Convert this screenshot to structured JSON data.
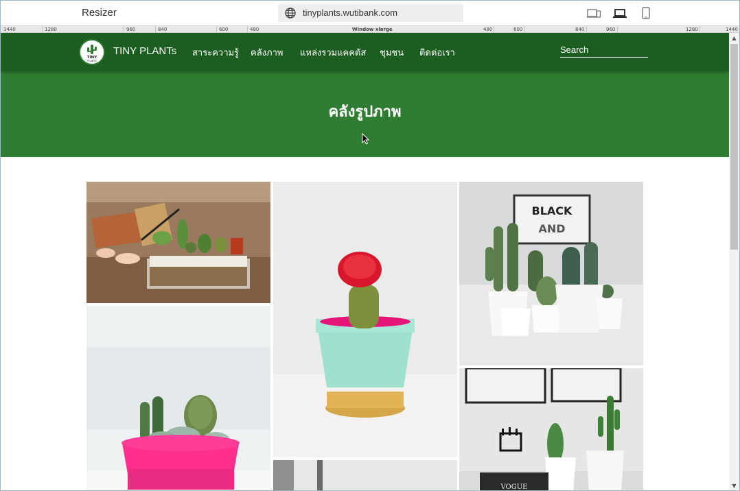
{
  "resizer": {
    "title": "Resizer",
    "url": "tinyplants.wutibank.com",
    "devices": [
      "desktop-tablet-icon",
      "laptop-icon",
      "phone-icon"
    ]
  },
  "ruler": {
    "labels_left": [
      "1440",
      "1280",
      "960",
      "840",
      "600",
      "480"
    ],
    "center_label": "Window xlarge",
    "labels_right": [
      "480",
      "600",
      "840",
      "960",
      "1280",
      "1440"
    ]
  },
  "site": {
    "brand": "TINY PLANTs",
    "logo_text": "TINY PLANTS",
    "nav": [
      "สาระความรู้",
      "คลังภาพ",
      "แหล่งรวมแคคตัส",
      "ชุมชน",
      "ติดต่อเรา"
    ],
    "search_placeholder": "Search",
    "hero_title": "คลังรูปภาพ",
    "colors": {
      "navbar": "#1b5e20",
      "hero": "#2e7d32"
    }
  },
  "gallery": [
    {
      "name": "cactus-terrarium-photo"
    },
    {
      "name": "red-moon-cactus-photo"
    },
    {
      "name": "potted-cacti-group-photo"
    },
    {
      "name": "pink-pot-succulents-photo"
    },
    {
      "name": "cacti-shelf-decor-photo"
    },
    {
      "name": "gallery-photo-partial"
    }
  ]
}
